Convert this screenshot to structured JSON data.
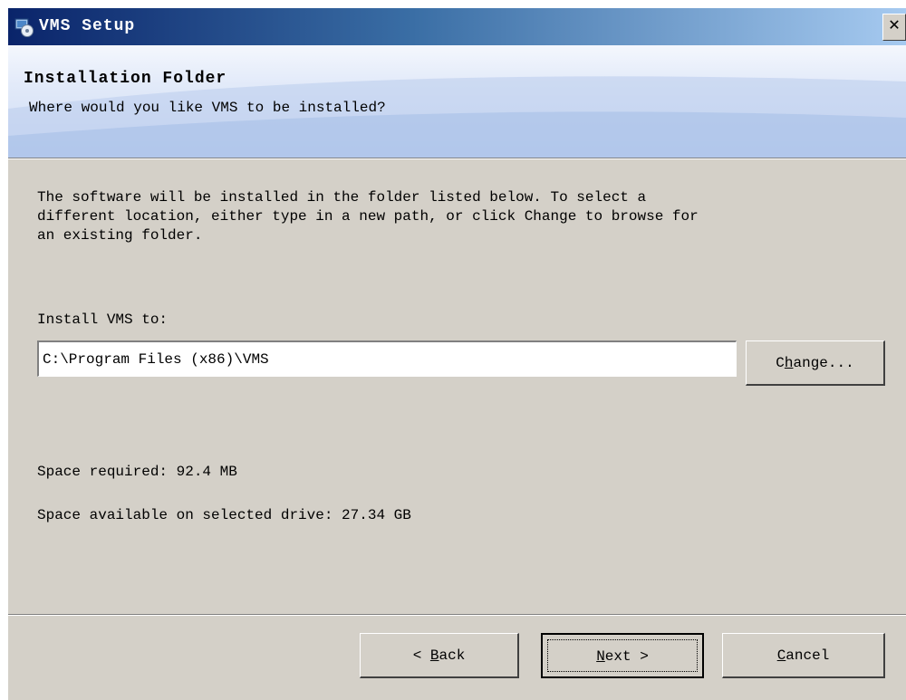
{
  "window": {
    "title": "VMS Setup",
    "close_label": "✕"
  },
  "header": {
    "title": "Installation Folder",
    "subtitle": "Where would you like VMS to be installed?"
  },
  "body": {
    "description": "The software will be installed in the folder listed below. To select a\ndifferent location, either type in a new path, or click Change to browse for\nan existing folder.",
    "install_label": "Install VMS to:",
    "install_path": "C:\\Program Files (x86)\\VMS",
    "change_button": {
      "pre": "C",
      "accel": "h",
      "post": "ange..."
    },
    "space_required": "Space required: 92.4 MB",
    "space_available": "Space available on selected drive: 27.34 GB"
  },
  "footer": {
    "back_button": {
      "pre": "< ",
      "accel": "B",
      "post": "ack"
    },
    "next_button": {
      "pre": "",
      "accel": "N",
      "post": "ext >"
    },
    "cancel_button": {
      "pre": "",
      "accel": "C",
      "post": "ancel"
    }
  },
  "icons": {
    "app": "installer-icon",
    "close": "close-icon"
  },
  "colors": {
    "titlebar_start": "#0a246a",
    "titlebar_end": "#a6caf0",
    "dialog_bg": "#d4d0c8",
    "header_bg": "#dfe8f8"
  }
}
